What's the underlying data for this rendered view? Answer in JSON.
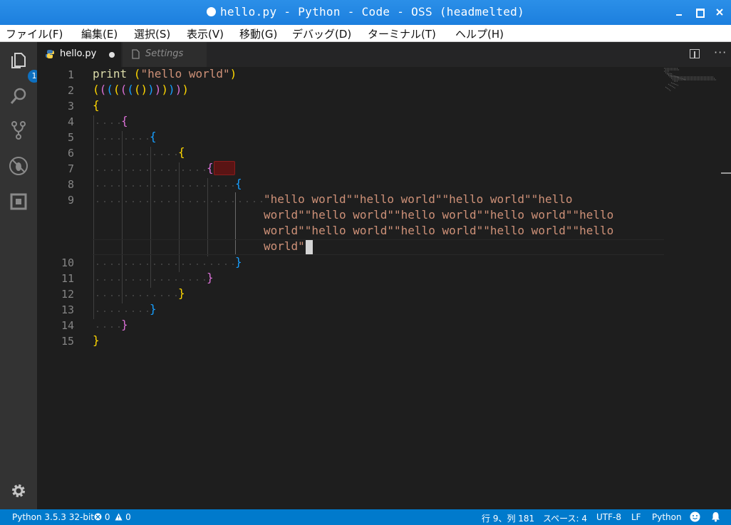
{
  "window": {
    "title": "hello.py - Python - Code - OSS (headmelted)"
  },
  "menu": [
    "ファイル(F)",
    "編集(E)",
    "選択(S)",
    "表示(V)",
    "移動(G)",
    "デバッグ(D)",
    "ターミナル(T)",
    "ヘルプ(H)"
  ],
  "activity": {
    "explorer_badge": "1"
  },
  "tabs": [
    {
      "label": "hello.py",
      "icon": "python-icon",
      "dirty": true,
      "active": true
    },
    {
      "label": "Settings",
      "icon": "file-icon",
      "dirty": false,
      "active": false
    }
  ],
  "editor": {
    "line_numbers": [
      "1",
      "2",
      "3",
      "4",
      "5",
      "6",
      "7",
      "8",
      "9",
      "10",
      "11",
      "12",
      "13",
      "14",
      "15"
    ],
    "line1": {
      "kw": "print",
      "rest_open": " (",
      "str": "\"hello world\"",
      "close": ")"
    },
    "line2": [
      "(",
      "(",
      "(",
      "(",
      "(",
      "(",
      "(",
      ")",
      ")",
      ")",
      ")",
      ")",
      ")",
      ")"
    ],
    "brace_open": "{",
    "brace_close": "}",
    "wrapped_lines": [
      "\"hello world\"\"hello world\"\"hello world\"\"hello",
      "world\"\"hello world\"\"hello world\"\"hello world\"\"hello",
      "world\"\"hello world\"\"hello world\"\"hello world\"\"hello",
      "world\""
    ]
  },
  "status": {
    "interpreter": "Python 3.5.3 32-bit",
    "errors": "0",
    "warnings": "0",
    "position": "行 9、列 181",
    "spaces": "スペース: 4",
    "encoding": "UTF-8",
    "eol": "LF",
    "language": "Python"
  },
  "colors": {
    "statusbar": "#007acc",
    "titlebar": "#1c7fde",
    "string": "#ce9178"
  }
}
